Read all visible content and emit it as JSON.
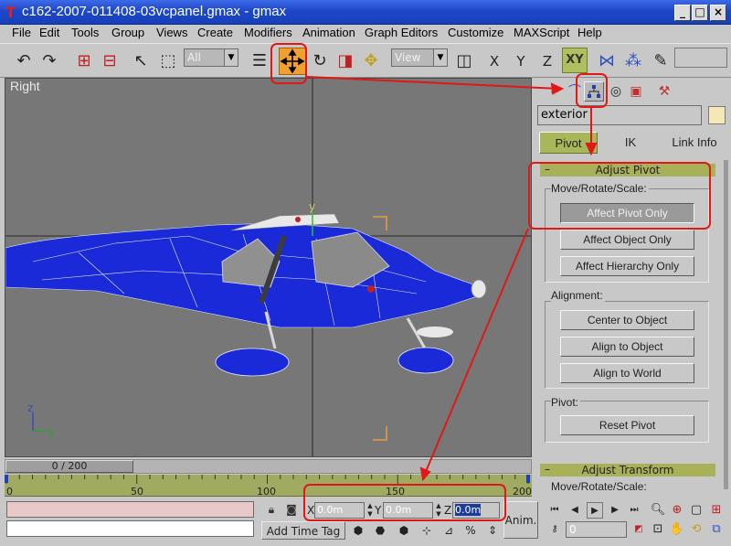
{
  "window": {
    "title": "c162-2007-011408-03vcpanel.gmax - gmax",
    "controls": [
      "_",
      "□",
      "×"
    ]
  },
  "menu": [
    "File",
    "Edit",
    "Tools",
    "Group",
    "Views",
    "Create",
    "Modifiers",
    "Animation",
    "Graph Editors",
    "Customize",
    "MAXScript",
    "Help"
  ],
  "toolbar": {
    "selection_filter": "All",
    "reference_coord": "View",
    "x_label": "X",
    "y_label": "Y",
    "z_label": "Z",
    "xy_label": "XY",
    "icons": [
      "undo-icon",
      "redo-icon",
      "select-link-icon",
      "unlink-icon",
      "select-icon",
      "region-select-icon",
      "select-by-name-icon",
      "move-icon",
      "rotate-icon",
      "scale-icon",
      "pivot-icon",
      "mirror-icon",
      "array-icon",
      "align-icon",
      "snap-icon"
    ]
  },
  "viewport": {
    "label": "Right",
    "axis_z": "z",
    "axis_y": "y",
    "gizmo_y": "y"
  },
  "panel": {
    "object_name": "exterior",
    "tabs": [
      "Pivot",
      "IK",
      "Link Info"
    ],
    "adjust_pivot": {
      "title": "Adjust Pivot",
      "collapse": "–",
      "move_group": "Move/Rotate/Scale:",
      "move_buttons": [
        "Affect Pivot Only",
        "Affect Object Only",
        "Affect Hierarchy Only"
      ],
      "align_group": "Alignment:",
      "align_buttons": [
        "Center to Object",
        "Align to Object",
        "Align to World"
      ],
      "pivot_group": "Pivot:",
      "pivot_buttons": [
        "Reset Pivot"
      ]
    },
    "adjust_transform": {
      "title": "Adjust Transform",
      "collapse": "–",
      "move_group": "Move/Rotate/Scale:"
    }
  },
  "timeline": {
    "slider_label": "0 / 200",
    "ticks": [
      "0",
      "50",
      "100",
      "150",
      "200"
    ],
    "tick_marks": [
      0,
      50,
      100,
      150,
      200
    ]
  },
  "status": {
    "x_label": "X",
    "y_label": "Y",
    "z_label": "Z",
    "x_value": "0.0m",
    "y_value": "0.0m",
    "z_value": "0.0m",
    "add_time_tag": "Add Time Tag",
    "anim_label": "Anim.",
    "frame_value": "0"
  },
  "colors": {
    "annotation": "#e01818",
    "active_tool": "#f0a030",
    "active_tab": "#a8b858",
    "rollout_header": "#a8b058",
    "viewport_bg": "#777777",
    "aircraft_body": "#1a2ad8"
  }
}
